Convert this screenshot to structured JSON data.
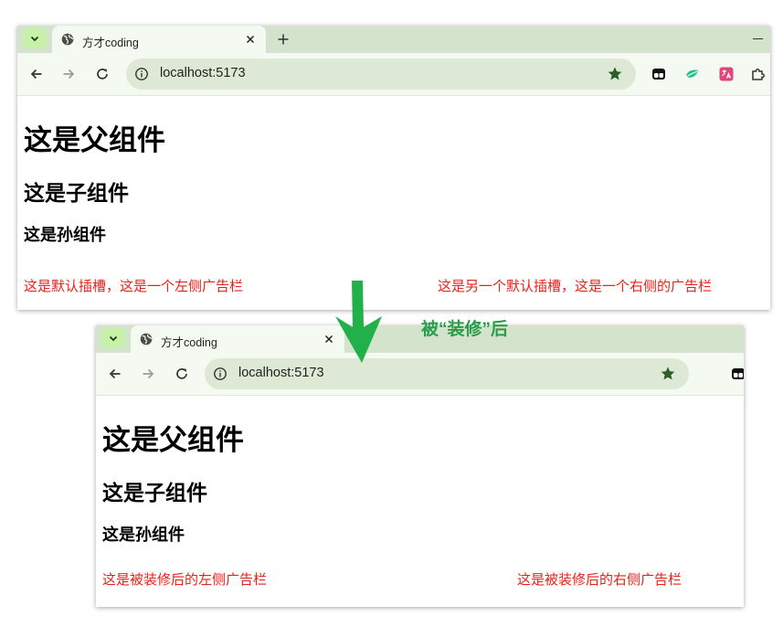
{
  "browsers": [
    {
      "tab_title": "方才coding",
      "url": "localhost:5173",
      "content": {
        "parent_heading": "这是父组件",
        "child_heading": "这是子组件",
        "grandchild_heading": "这是孙组件",
        "left_ad": "这是默认插槽，这是一个左侧广告栏",
        "right_ad": "这是另一个默认插槽，这是一个右侧的广告栏"
      }
    },
    {
      "tab_title": "方才coding",
      "url": "localhost:5173",
      "content": {
        "parent_heading": "这是父组件",
        "child_heading": "这是子组件",
        "grandchild_heading": "这是孙组件",
        "left_ad": "这是被装修后的左侧广告栏",
        "right_ad": "这是被装修后的右侧广告栏"
      }
    }
  ],
  "annotation": {
    "caption": "被“装修”后",
    "arrow_color": "#22b04b",
    "caption_color": "#2a9d48"
  },
  "colors": {
    "tab_strip": "#d3e3cc",
    "toolbar": "#f4f9f1",
    "omnibox": "#dde9d5",
    "ad_text": "#e8211a"
  },
  "icons": [
    "chevron-down-icon",
    "globe-icon",
    "close-icon",
    "plus-icon",
    "minimize-icon",
    "back-arrow-icon",
    "forward-arrow-icon",
    "reload-icon",
    "info-icon",
    "star-icon",
    "extension-icon",
    "puzzle-icon"
  ]
}
